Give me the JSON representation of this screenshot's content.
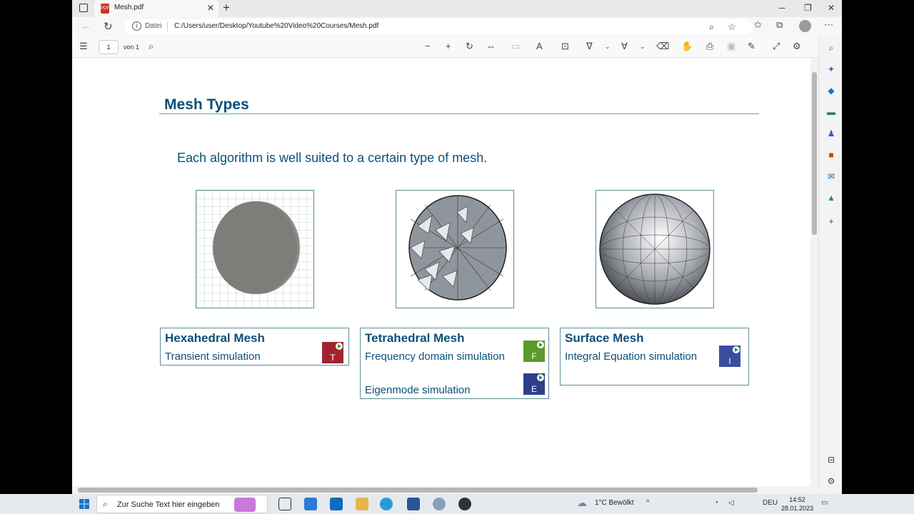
{
  "tab": {
    "title": "Mesh.pdf",
    "pdf_glyph": "PDF"
  },
  "address": {
    "scheme_label": "Datei",
    "url": "C:/Users/user/Desktop/Youtube%20Video%20Courses/Mesh.pdf"
  },
  "pdf_toolbar": {
    "page_number": "1",
    "page_total": "von 1"
  },
  "slide": {
    "title": "Mesh Types",
    "subtitle": "Each algorithm is well suited to a certain type of mesh.",
    "cards": [
      {
        "title": "Hexahedral Mesh",
        "lines": [
          "Transient simulation"
        ],
        "badges": [
          "T"
        ],
        "badge_colors": [
          "#a3222f"
        ]
      },
      {
        "title": "Tetrahedral Mesh",
        "lines": [
          "Frequency domain simulation",
          "Eigenmode simulation"
        ],
        "badges": [
          "F",
          "E"
        ],
        "badge_colors": [
          "#5a9a2a",
          "#2e3f8a"
        ]
      },
      {
        "title": "Surface Mesh",
        "lines": [
          "Integral Equation simulation"
        ],
        "badges": [
          "I"
        ],
        "badge_colors": [
          "#3a4ea0"
        ]
      }
    ]
  },
  "taskbar": {
    "search_placeholder": "Zur Suche Text hier eingeben",
    "weather": "1°C  Bewölkt",
    "language": "DEU",
    "time": "14:52",
    "date": "28.01.2023"
  },
  "colors": {
    "accent": "#0b4f78",
    "rule": "#6a9fab",
    "box_border": "#5c8f97"
  }
}
